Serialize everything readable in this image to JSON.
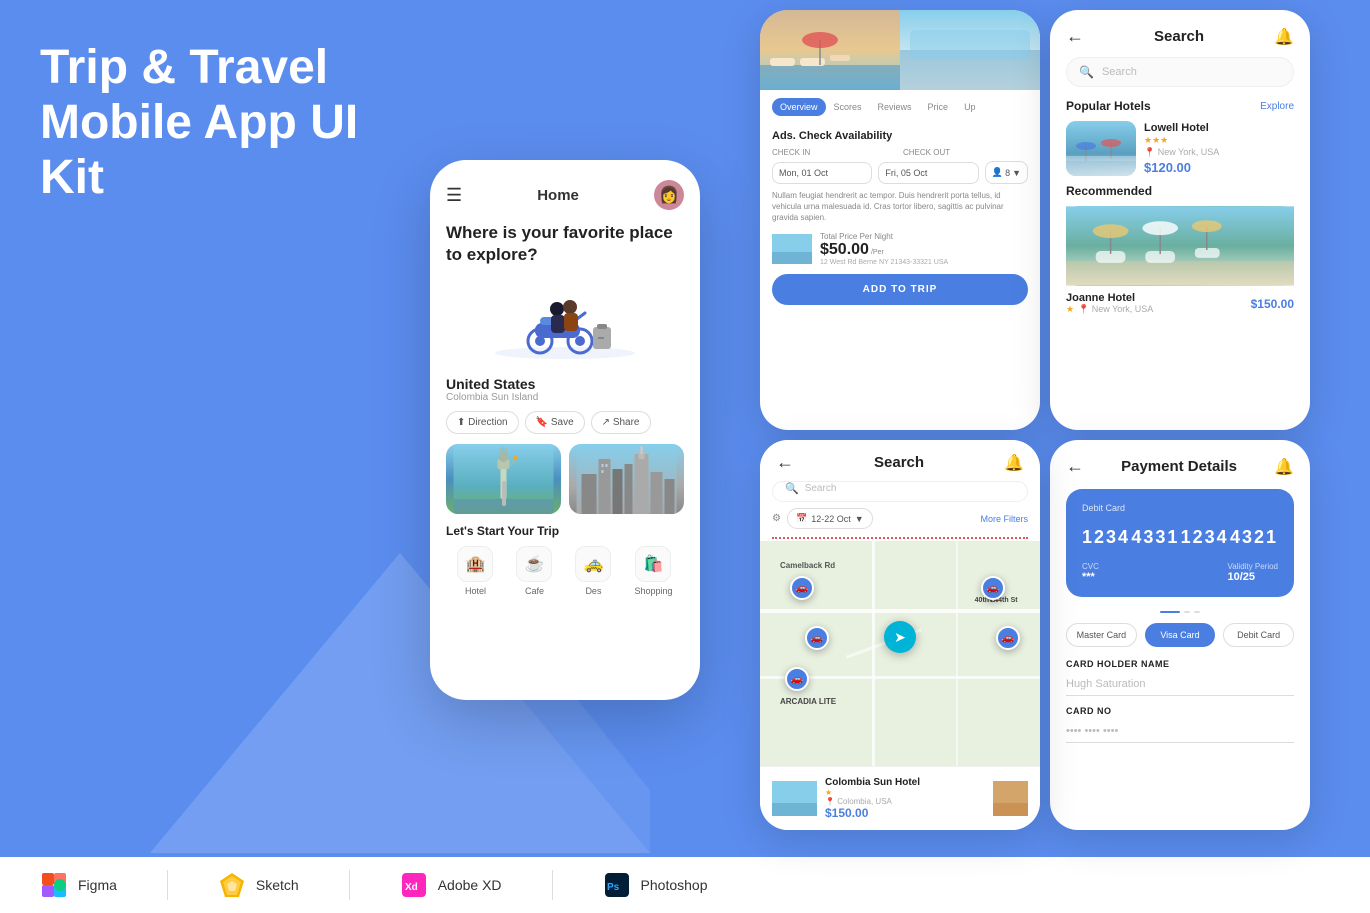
{
  "hero": {
    "title": "Trip & Travel\nMobile App UI Kit"
  },
  "phone_home": {
    "menu_icon": "☰",
    "title": "Home",
    "question": "Where is your favorite place to explore?",
    "location_name": "United States",
    "location_sub": "Colombia Sun Island",
    "action_buttons": [
      "Direction",
      "Save",
      "Share"
    ],
    "section_title": "Let's Start Your Trip",
    "categories": [
      {
        "icon": "🏨",
        "label": "Hotel"
      },
      {
        "icon": "☕",
        "label": "Cafe"
      },
      {
        "icon": "🚕",
        "label": "Des"
      },
      {
        "icon": "🛍️",
        "label": "Shopping"
      }
    ]
  },
  "hotel_detail": {
    "tabs": [
      "Overview",
      "Scores",
      "Reviews",
      "Price",
      "Up"
    ],
    "check_in_label": "CHECK IN",
    "check_out_label": "CHECK OUT",
    "check_in_value": "Mon, 01 Oct",
    "check_out_value": "Fri, 05 Oct",
    "guests": "8",
    "ads_title": "Ads. Check Availability",
    "desc": "Nullam feugiat hendrerit ac tempor. Duis hendrerit porta tellus, id vehicula urna malesuada id. Cras tortor libero, sagittis ac pulvinar gravida sapien.",
    "price_label": "Total Price Per Night",
    "price": "$50.00",
    "price_per": "/Per",
    "address": "12 West Rd Berne NY 21343-33321 USA",
    "add_trip": "ADD TO TRIP"
  },
  "search_screen": {
    "back": "←",
    "title": "Search",
    "bell": "🔔",
    "search_placeholder": "Search",
    "popular_hotels_title": "Popular Hotels",
    "explore": "Explore",
    "hotels": [
      {
        "name": "Lowell Hotel",
        "stars": "★★★",
        "location": "New York, USA",
        "price": "$120.00"
      }
    ],
    "recommended_title": "Recommended",
    "recommended_hotels": [
      {
        "name": "Joanne Hotel",
        "stars": "★",
        "location": "New York, USA",
        "price": "$150.00"
      }
    ]
  },
  "map_screen": {
    "back": "←",
    "title": "Search",
    "bell": "🔔",
    "date_filter": "12-22 Oct",
    "more_filters": "More Filters",
    "search_placeholder": "Search",
    "hotel_name": "Colombia Sun Hotel",
    "hotel_stars": "★",
    "hotel_location": "Colombia, USA",
    "hotel_price": "$150.00"
  },
  "payment_screen": {
    "back": "←",
    "title": "Payment Details",
    "bell": "🔔",
    "card_label": "Debit Card",
    "card_number": [
      "1234",
      "4331",
      "1234",
      "4321"
    ],
    "cvc_label": "CVC",
    "cvc_value": "***",
    "validity_label": "Validity Period",
    "validity_value": "10/25",
    "card_types": [
      "Master Card",
      "Visa Card",
      "Debit Card"
    ],
    "active_card_type": "Visa Card",
    "holder_label": "CARD HOLDER NAME",
    "holder_value": "Hugh Saturation",
    "card_no_label": "CARD NO",
    "card_no_value": "•••• •••• ••••"
  },
  "tools": [
    {
      "name": "Figma",
      "icon_type": "figma"
    },
    {
      "name": "Sketch",
      "icon_type": "sketch"
    },
    {
      "name": "Adobe XD",
      "icon_type": "xd",
      "prefix": "Xd"
    },
    {
      "name": "Photoshop",
      "icon_type": "ps",
      "prefix": "Ps"
    }
  ]
}
